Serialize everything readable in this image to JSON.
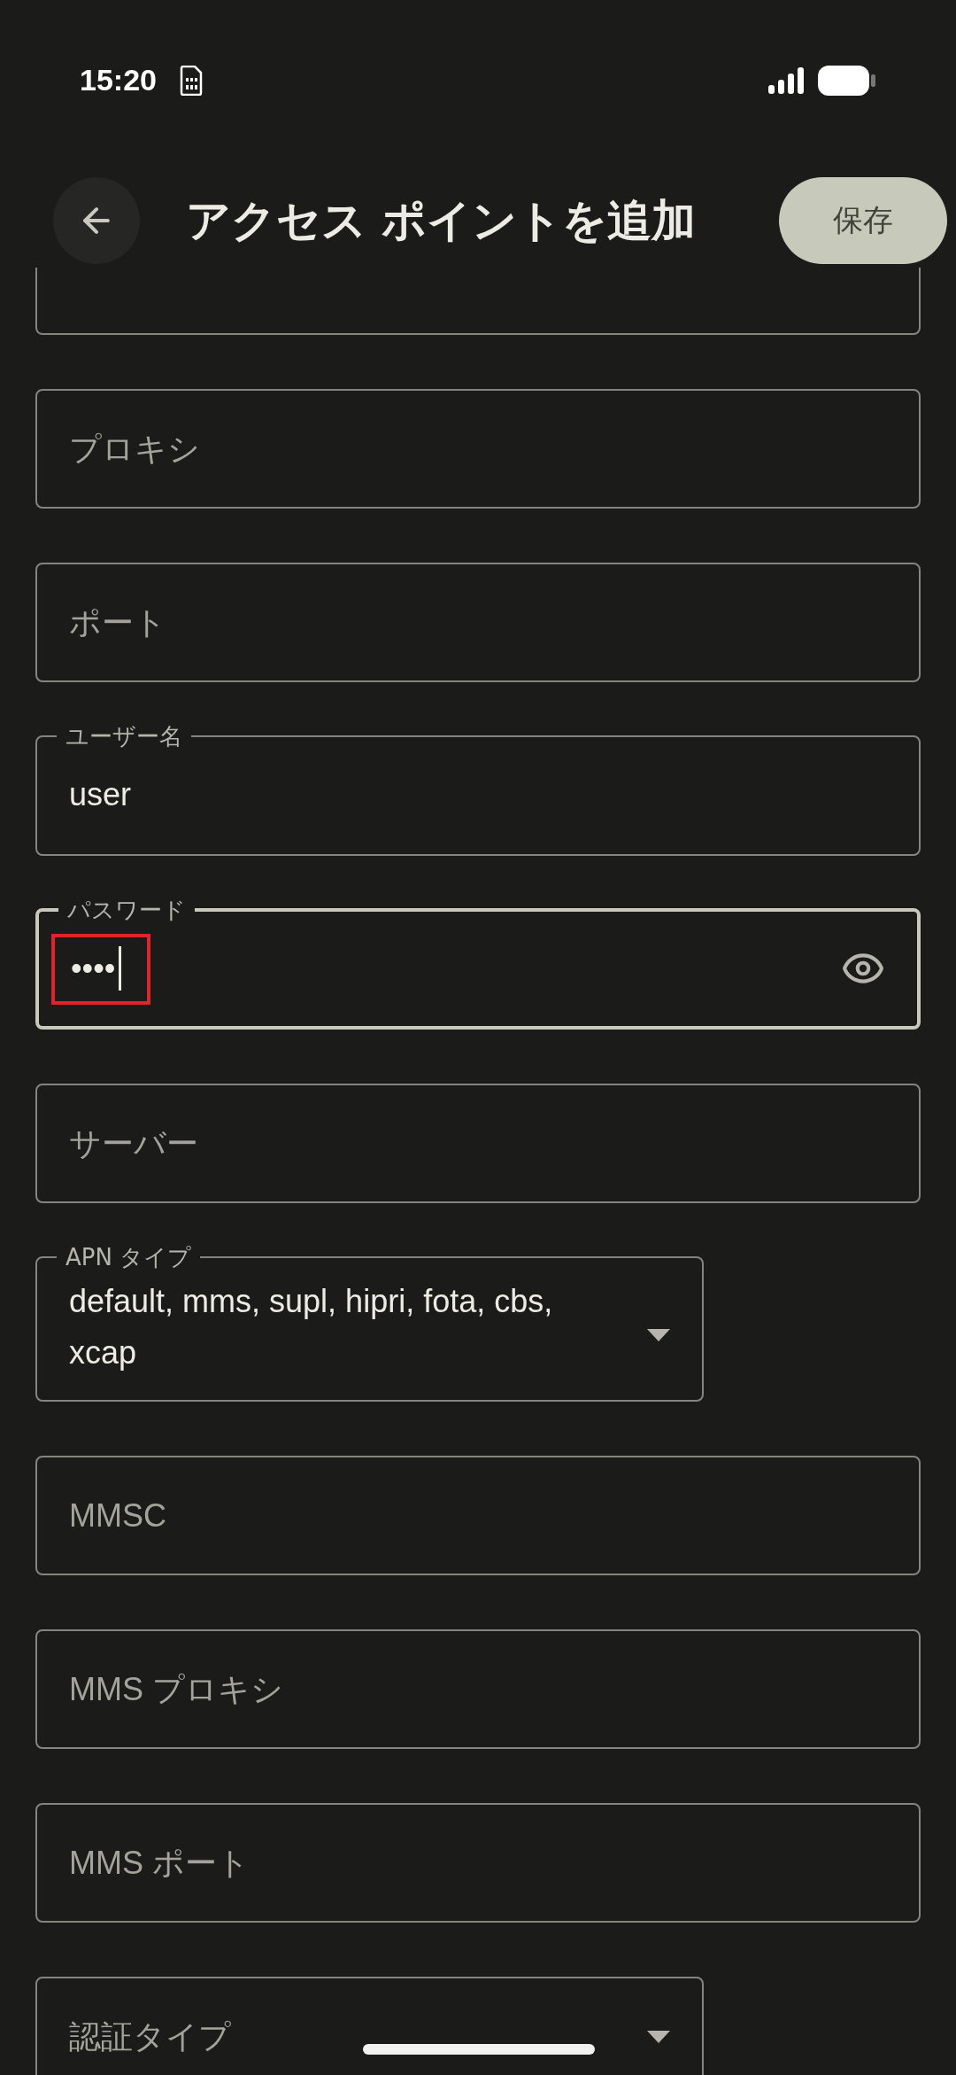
{
  "status_bar": {
    "time": "15:20"
  },
  "header": {
    "title": "アクセス ポイントを追加",
    "save_button": "保存"
  },
  "fields": [
    {
      "kind": "text",
      "focused": false
    },
    {
      "kind": "text",
      "placeholder": "プロキシ",
      "focused": false
    },
    {
      "kind": "text",
      "placeholder": "ポート",
      "focused": false
    },
    {
      "kind": "text",
      "label": "ユーザー名",
      "value": "user",
      "focused": false
    },
    {
      "kind": "password",
      "label": "パスワード",
      "value": "••••",
      "focused": true
    },
    {
      "kind": "text",
      "placeholder": "サーバー",
      "focused": false
    },
    {
      "kind": "dropdown",
      "label": "APN タイプ",
      "value": "default, mms, supl, hipri, fota, cbs, xcap",
      "focused": false
    },
    {
      "kind": "text",
      "placeholder": "MMSC",
      "focused": false
    },
    {
      "kind": "text",
      "placeholder": "MMS プロキシ",
      "focused": false
    },
    {
      "kind": "text",
      "placeholder": "MMS ポート",
      "focused": false
    },
    {
      "kind": "dropdown",
      "placeholder": "認証タイプ",
      "focused": false
    }
  ]
}
